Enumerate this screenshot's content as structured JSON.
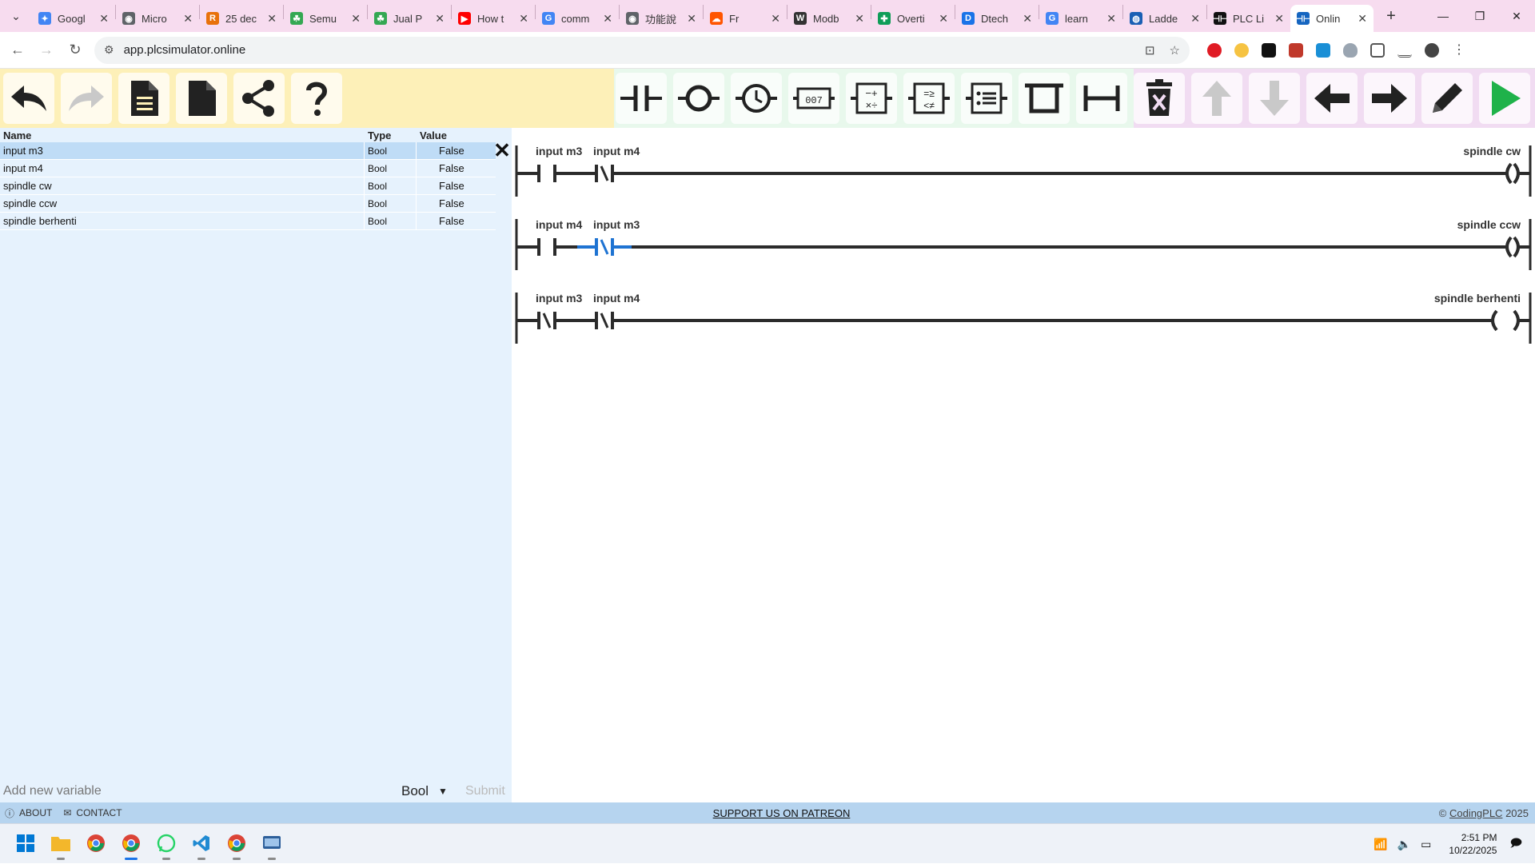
{
  "browser": {
    "tabs": [
      {
        "label": "Googl",
        "color": "#4285f4",
        "glyph": "✦"
      },
      {
        "label": "Micro",
        "color": "#5f6368",
        "glyph": "◉"
      },
      {
        "label": "25 dec",
        "color": "#e8710a",
        "glyph": "R"
      },
      {
        "label": "Semu",
        "color": "#34a853",
        "glyph": "☘"
      },
      {
        "label": "Jual P",
        "color": "#34a853",
        "glyph": "☘"
      },
      {
        "label": "How t",
        "color": "#ff0000",
        "glyph": "▶"
      },
      {
        "label": "comm",
        "color": "#4285f4",
        "glyph": "G"
      },
      {
        "label": "功能說",
        "color": "#5f6368",
        "glyph": "◉"
      },
      {
        "label": "Fr",
        "color": "#ff5500",
        "glyph": "☁"
      },
      {
        "label": "Modb",
        "color": "#333333",
        "glyph": "W"
      },
      {
        "label": "Overti",
        "color": "#0f9d58",
        "glyph": "✚"
      },
      {
        "label": "Dtech",
        "color": "#1a73e8",
        "glyph": "D"
      },
      {
        "label": "learn",
        "color": "#4285f4",
        "glyph": "G"
      },
      {
        "label": "Ladde",
        "color": "#1a5fb4",
        "glyph": "◍"
      },
      {
        "label": "PLC Li",
        "color": "#111111",
        "glyph": "⊣⊢"
      },
      {
        "label": "Onlin",
        "color": "#1565c0",
        "glyph": "⊣⊢"
      }
    ],
    "url": "app.plcsimulator.online"
  },
  "variables": {
    "headers": {
      "name": "Name",
      "type": "Type",
      "value": "Value"
    },
    "rows": [
      {
        "name": "input m3",
        "type": "Bool",
        "value": "False"
      },
      {
        "name": "input m4",
        "type": "Bool",
        "value": "False"
      },
      {
        "name": "spindle cw",
        "type": "Bool",
        "value": "False"
      },
      {
        "name": "spindle ccw",
        "type": "Bool",
        "value": "False"
      },
      {
        "name": "spindle berhenti",
        "type": "Bool",
        "value": "False"
      }
    ],
    "add_placeholder": "Add new variable",
    "add_type": "Bool",
    "submit_label": "Submit"
  },
  "ladder": {
    "rungs": [
      {
        "contacts": [
          {
            "label": "input m3",
            "kind": "NO"
          },
          {
            "label": "input m4",
            "kind": "NC"
          }
        ],
        "coil": "spindle cw",
        "selected": false
      },
      {
        "contacts": [
          {
            "label": "input m4",
            "kind": "NO"
          },
          {
            "label": "input m3",
            "kind": "NC"
          }
        ],
        "coil": "spindle ccw",
        "selected": true
      },
      {
        "contacts": [
          {
            "label": "input m3",
            "kind": "NC"
          },
          {
            "label": "input m4",
            "kind": "NC"
          }
        ],
        "coil": "spindle berhenti",
        "selected": false
      }
    ]
  },
  "footer": {
    "about": "ABOUT",
    "contact": "CONTACT",
    "patreon": "SUPPORT US ON PATREON",
    "copyright_prefix": "©",
    "copyright_link": "CodingPLC",
    "copyright_year": "2025"
  },
  "taskbar": {
    "time": "2:51 PM",
    "date": "10/22/2025"
  },
  "colors": {
    "selected_rung": "#1e73d2",
    "rung_line": "#2b2b2b",
    "run_button": "#1fb24a"
  }
}
